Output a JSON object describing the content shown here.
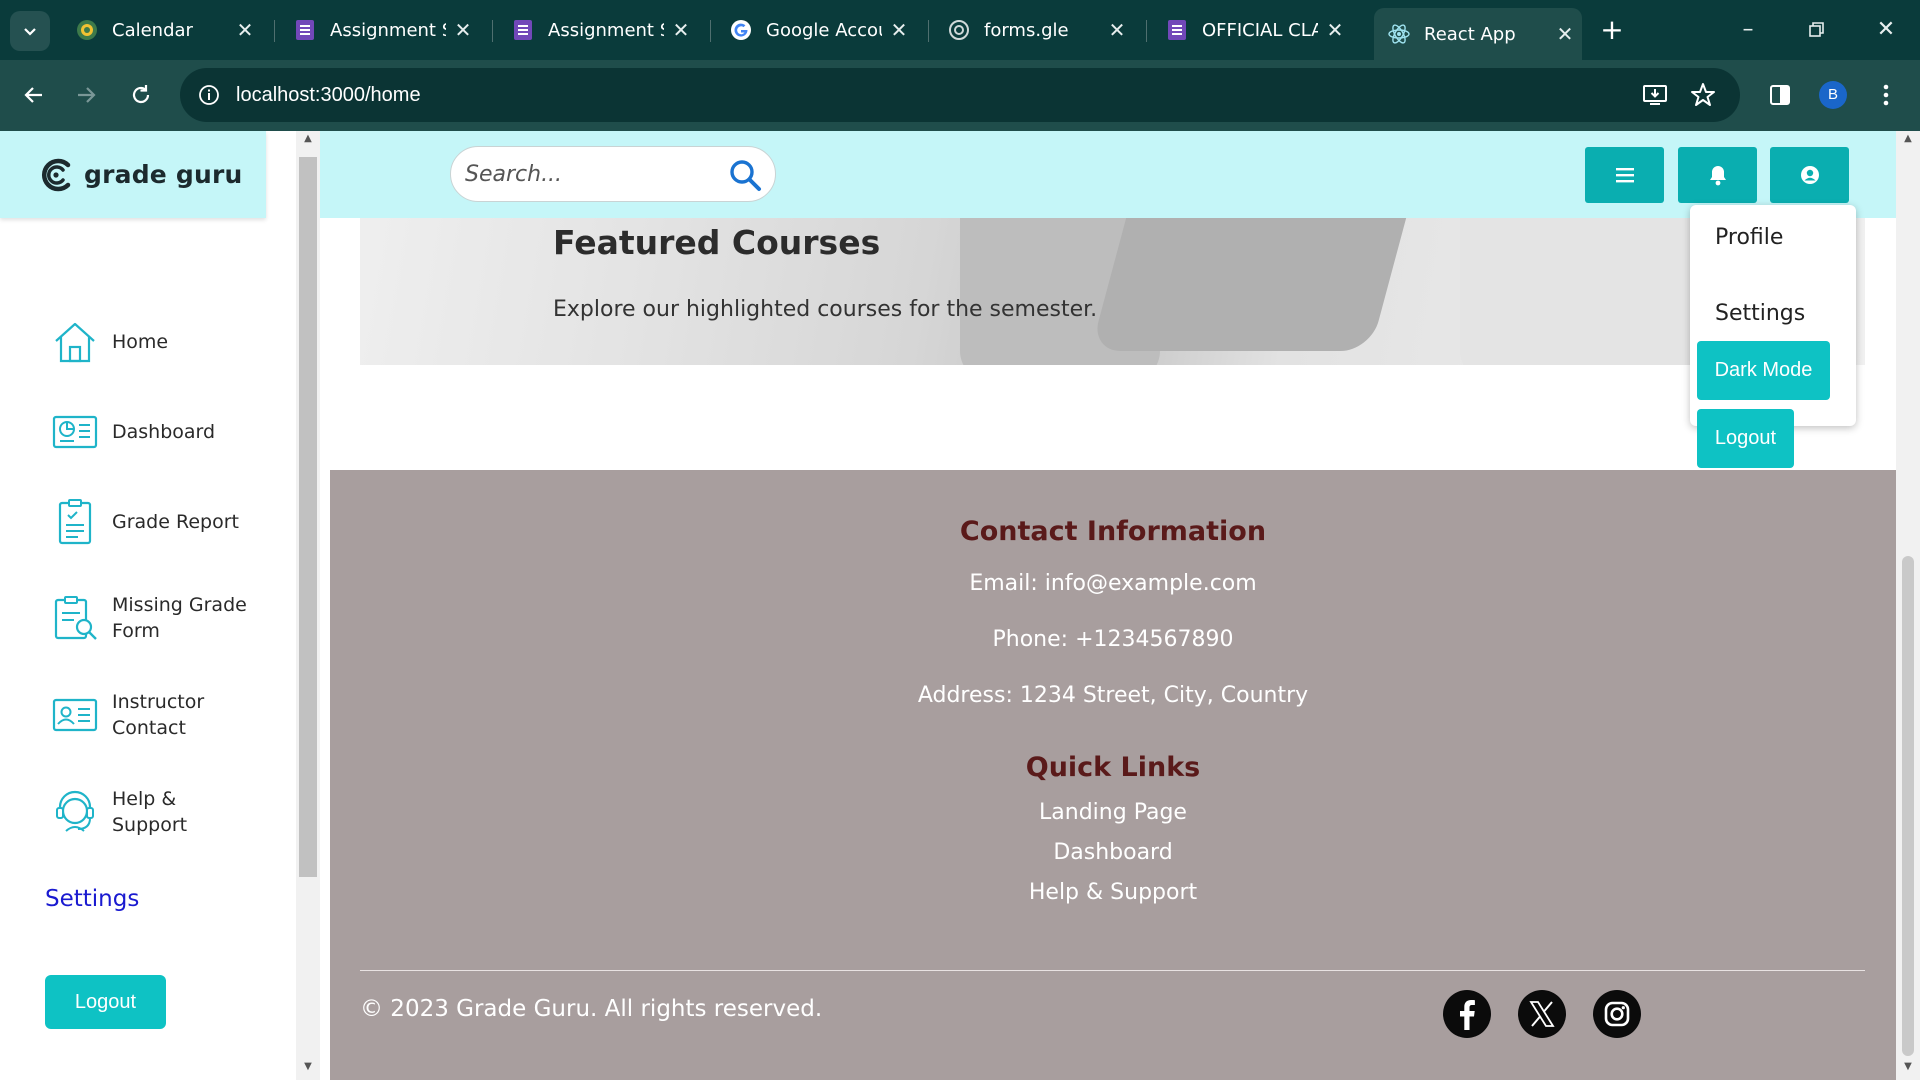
{
  "browser": {
    "tabs": [
      {
        "title": "Calendar",
        "icon": "calendar-favicon"
      },
      {
        "title": "Assignment Su",
        "icon": "forms-favicon"
      },
      {
        "title": "Assignment Su",
        "icon": "forms-favicon"
      },
      {
        "title": "Google Accou",
        "icon": "google-favicon"
      },
      {
        "title": "forms.gle",
        "icon": "globe-favicon"
      },
      {
        "title": "OFFICIAL CLA",
        "icon": "forms-favicon"
      },
      {
        "title": "React App",
        "icon": "react-favicon",
        "active": true
      }
    ],
    "new_tab_label": "+",
    "url": "localhost:3000/home",
    "profile_initial": "B"
  },
  "brand": {
    "name": "grade guru"
  },
  "sidebar": {
    "items": [
      {
        "label": "Home",
        "icon": "home-icon"
      },
      {
        "label": "Dashboard",
        "icon": "dashboard-icon"
      },
      {
        "label": "Grade Report",
        "icon": "grade-report-icon"
      },
      {
        "label": "Missing Grade Form",
        "icon": "missing-grade-icon"
      },
      {
        "label": "Instructor Contact",
        "icon": "contact-card-icon"
      },
      {
        "label": "Help & Support",
        "icon": "support-icon"
      }
    ],
    "settings_label": "Settings",
    "logout_label": "Logout"
  },
  "topnav": {
    "search_placeholder": "Search...",
    "buttons": [
      "menu-icon",
      "bell-icon",
      "user-icon"
    ]
  },
  "dropdown": {
    "profile_label": "Profile",
    "settings_label": "Settings",
    "dark_mode_label": "Dark Mode",
    "logout_label": "Logout"
  },
  "hero": {
    "title": "Featured Courses",
    "subtitle": "Explore our highlighted courses for the semester."
  },
  "footer": {
    "contact_heading": "Contact Information",
    "email": "Email: info@example.com",
    "phone": "Phone: +1234567890",
    "address": "Address: 1234 Street, City, Country",
    "links_heading": "Quick Links",
    "links": [
      "Landing Page",
      "Dashboard",
      "Help & Support"
    ],
    "copyright": "© 2023 Grade Guru. All rights reserved.",
    "social": [
      "facebook-icon",
      "x-icon",
      "instagram-icon"
    ]
  },
  "colors": {
    "accent": "#0ec2c4",
    "header_bg": "#c5f6f8",
    "footer_bg": "#a89e9e",
    "footer_heading": "#5a1a1a",
    "browser_frame": "#1f4d4b"
  }
}
